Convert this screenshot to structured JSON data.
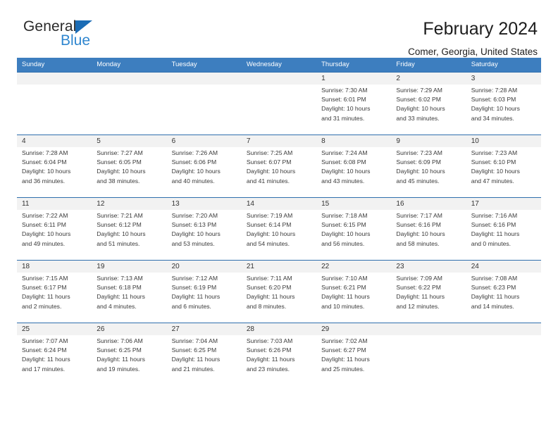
{
  "brand": {
    "name_top": "General",
    "name_bottom": "Blue"
  },
  "header": {
    "title": "February 2024",
    "subtitle": "Comer, Georgia, United States"
  },
  "colors": {
    "header_blue": "#3d7ebf",
    "row_divider_blue": "#2f6fad",
    "brand_blue": "#2f86cf",
    "daterow_gray": "#f2f2f2"
  },
  "calendar": {
    "weekdays": [
      "Sunday",
      "Monday",
      "Tuesday",
      "Wednesday",
      "Thursday",
      "Friday",
      "Saturday"
    ],
    "weeks": [
      [
        {
          "day": "",
          "sunrise": "",
          "sunset": "",
          "daylight_line1": "",
          "daylight_line2": ""
        },
        {
          "day": "",
          "sunrise": "",
          "sunset": "",
          "daylight_line1": "",
          "daylight_line2": ""
        },
        {
          "day": "",
          "sunrise": "",
          "sunset": "",
          "daylight_line1": "",
          "daylight_line2": ""
        },
        {
          "day": "",
          "sunrise": "",
          "sunset": "",
          "daylight_line1": "",
          "daylight_line2": ""
        },
        {
          "day": "1",
          "sunrise": "Sunrise: 7:30 AM",
          "sunset": "Sunset: 6:01 PM",
          "daylight_line1": "Daylight: 10 hours",
          "daylight_line2": "and 31 minutes."
        },
        {
          "day": "2",
          "sunrise": "Sunrise: 7:29 AM",
          "sunset": "Sunset: 6:02 PM",
          "daylight_line1": "Daylight: 10 hours",
          "daylight_line2": "and 33 minutes."
        },
        {
          "day": "3",
          "sunrise": "Sunrise: 7:28 AM",
          "sunset": "Sunset: 6:03 PM",
          "daylight_line1": "Daylight: 10 hours",
          "daylight_line2": "and 34 minutes."
        }
      ],
      [
        {
          "day": "4",
          "sunrise": "Sunrise: 7:28 AM",
          "sunset": "Sunset: 6:04 PM",
          "daylight_line1": "Daylight: 10 hours",
          "daylight_line2": "and 36 minutes."
        },
        {
          "day": "5",
          "sunrise": "Sunrise: 7:27 AM",
          "sunset": "Sunset: 6:05 PM",
          "daylight_line1": "Daylight: 10 hours",
          "daylight_line2": "and 38 minutes."
        },
        {
          "day": "6",
          "sunrise": "Sunrise: 7:26 AM",
          "sunset": "Sunset: 6:06 PM",
          "daylight_line1": "Daylight: 10 hours",
          "daylight_line2": "and 40 minutes."
        },
        {
          "day": "7",
          "sunrise": "Sunrise: 7:25 AM",
          "sunset": "Sunset: 6:07 PM",
          "daylight_line1": "Daylight: 10 hours",
          "daylight_line2": "and 41 minutes."
        },
        {
          "day": "8",
          "sunrise": "Sunrise: 7:24 AM",
          "sunset": "Sunset: 6:08 PM",
          "daylight_line1": "Daylight: 10 hours",
          "daylight_line2": "and 43 minutes."
        },
        {
          "day": "9",
          "sunrise": "Sunrise: 7:23 AM",
          "sunset": "Sunset: 6:09 PM",
          "daylight_line1": "Daylight: 10 hours",
          "daylight_line2": "and 45 minutes."
        },
        {
          "day": "10",
          "sunrise": "Sunrise: 7:23 AM",
          "sunset": "Sunset: 6:10 PM",
          "daylight_line1": "Daylight: 10 hours",
          "daylight_line2": "and 47 minutes."
        }
      ],
      [
        {
          "day": "11",
          "sunrise": "Sunrise: 7:22 AM",
          "sunset": "Sunset: 6:11 PM",
          "daylight_line1": "Daylight: 10 hours",
          "daylight_line2": "and 49 minutes."
        },
        {
          "day": "12",
          "sunrise": "Sunrise: 7:21 AM",
          "sunset": "Sunset: 6:12 PM",
          "daylight_line1": "Daylight: 10 hours",
          "daylight_line2": "and 51 minutes."
        },
        {
          "day": "13",
          "sunrise": "Sunrise: 7:20 AM",
          "sunset": "Sunset: 6:13 PM",
          "daylight_line1": "Daylight: 10 hours",
          "daylight_line2": "and 53 minutes."
        },
        {
          "day": "14",
          "sunrise": "Sunrise: 7:19 AM",
          "sunset": "Sunset: 6:14 PM",
          "daylight_line1": "Daylight: 10 hours",
          "daylight_line2": "and 54 minutes."
        },
        {
          "day": "15",
          "sunrise": "Sunrise: 7:18 AM",
          "sunset": "Sunset: 6:15 PM",
          "daylight_line1": "Daylight: 10 hours",
          "daylight_line2": "and 56 minutes."
        },
        {
          "day": "16",
          "sunrise": "Sunrise: 7:17 AM",
          "sunset": "Sunset: 6:16 PM",
          "daylight_line1": "Daylight: 10 hours",
          "daylight_line2": "and 58 minutes."
        },
        {
          "day": "17",
          "sunrise": "Sunrise: 7:16 AM",
          "sunset": "Sunset: 6:16 PM",
          "daylight_line1": "Daylight: 11 hours",
          "daylight_line2": "and 0 minutes."
        }
      ],
      [
        {
          "day": "18",
          "sunrise": "Sunrise: 7:15 AM",
          "sunset": "Sunset: 6:17 PM",
          "daylight_line1": "Daylight: 11 hours",
          "daylight_line2": "and 2 minutes."
        },
        {
          "day": "19",
          "sunrise": "Sunrise: 7:13 AM",
          "sunset": "Sunset: 6:18 PM",
          "daylight_line1": "Daylight: 11 hours",
          "daylight_line2": "and 4 minutes."
        },
        {
          "day": "20",
          "sunrise": "Sunrise: 7:12 AM",
          "sunset": "Sunset: 6:19 PM",
          "daylight_line1": "Daylight: 11 hours",
          "daylight_line2": "and 6 minutes."
        },
        {
          "day": "21",
          "sunrise": "Sunrise: 7:11 AM",
          "sunset": "Sunset: 6:20 PM",
          "daylight_line1": "Daylight: 11 hours",
          "daylight_line2": "and 8 minutes."
        },
        {
          "day": "22",
          "sunrise": "Sunrise: 7:10 AM",
          "sunset": "Sunset: 6:21 PM",
          "daylight_line1": "Daylight: 11 hours",
          "daylight_line2": "and 10 minutes."
        },
        {
          "day": "23",
          "sunrise": "Sunrise: 7:09 AM",
          "sunset": "Sunset: 6:22 PM",
          "daylight_line1": "Daylight: 11 hours",
          "daylight_line2": "and 12 minutes."
        },
        {
          "day": "24",
          "sunrise": "Sunrise: 7:08 AM",
          "sunset": "Sunset: 6:23 PM",
          "daylight_line1": "Daylight: 11 hours",
          "daylight_line2": "and 14 minutes."
        }
      ],
      [
        {
          "day": "25",
          "sunrise": "Sunrise: 7:07 AM",
          "sunset": "Sunset: 6:24 PM",
          "daylight_line1": "Daylight: 11 hours",
          "daylight_line2": "and 17 minutes."
        },
        {
          "day": "26",
          "sunrise": "Sunrise: 7:06 AM",
          "sunset": "Sunset: 6:25 PM",
          "daylight_line1": "Daylight: 11 hours",
          "daylight_line2": "and 19 minutes."
        },
        {
          "day": "27",
          "sunrise": "Sunrise: 7:04 AM",
          "sunset": "Sunset: 6:25 PM",
          "daylight_line1": "Daylight: 11 hours",
          "daylight_line2": "and 21 minutes."
        },
        {
          "day": "28",
          "sunrise": "Sunrise: 7:03 AM",
          "sunset": "Sunset: 6:26 PM",
          "daylight_line1": "Daylight: 11 hours",
          "daylight_line2": "and 23 minutes."
        },
        {
          "day": "29",
          "sunrise": "Sunrise: 7:02 AM",
          "sunset": "Sunset: 6:27 PM",
          "daylight_line1": "Daylight: 11 hours",
          "daylight_line2": "and 25 minutes."
        },
        {
          "day": "",
          "sunrise": "",
          "sunset": "",
          "daylight_line1": "",
          "daylight_line2": ""
        },
        {
          "day": "",
          "sunrise": "",
          "sunset": "",
          "daylight_line1": "",
          "daylight_line2": ""
        }
      ]
    ]
  }
}
